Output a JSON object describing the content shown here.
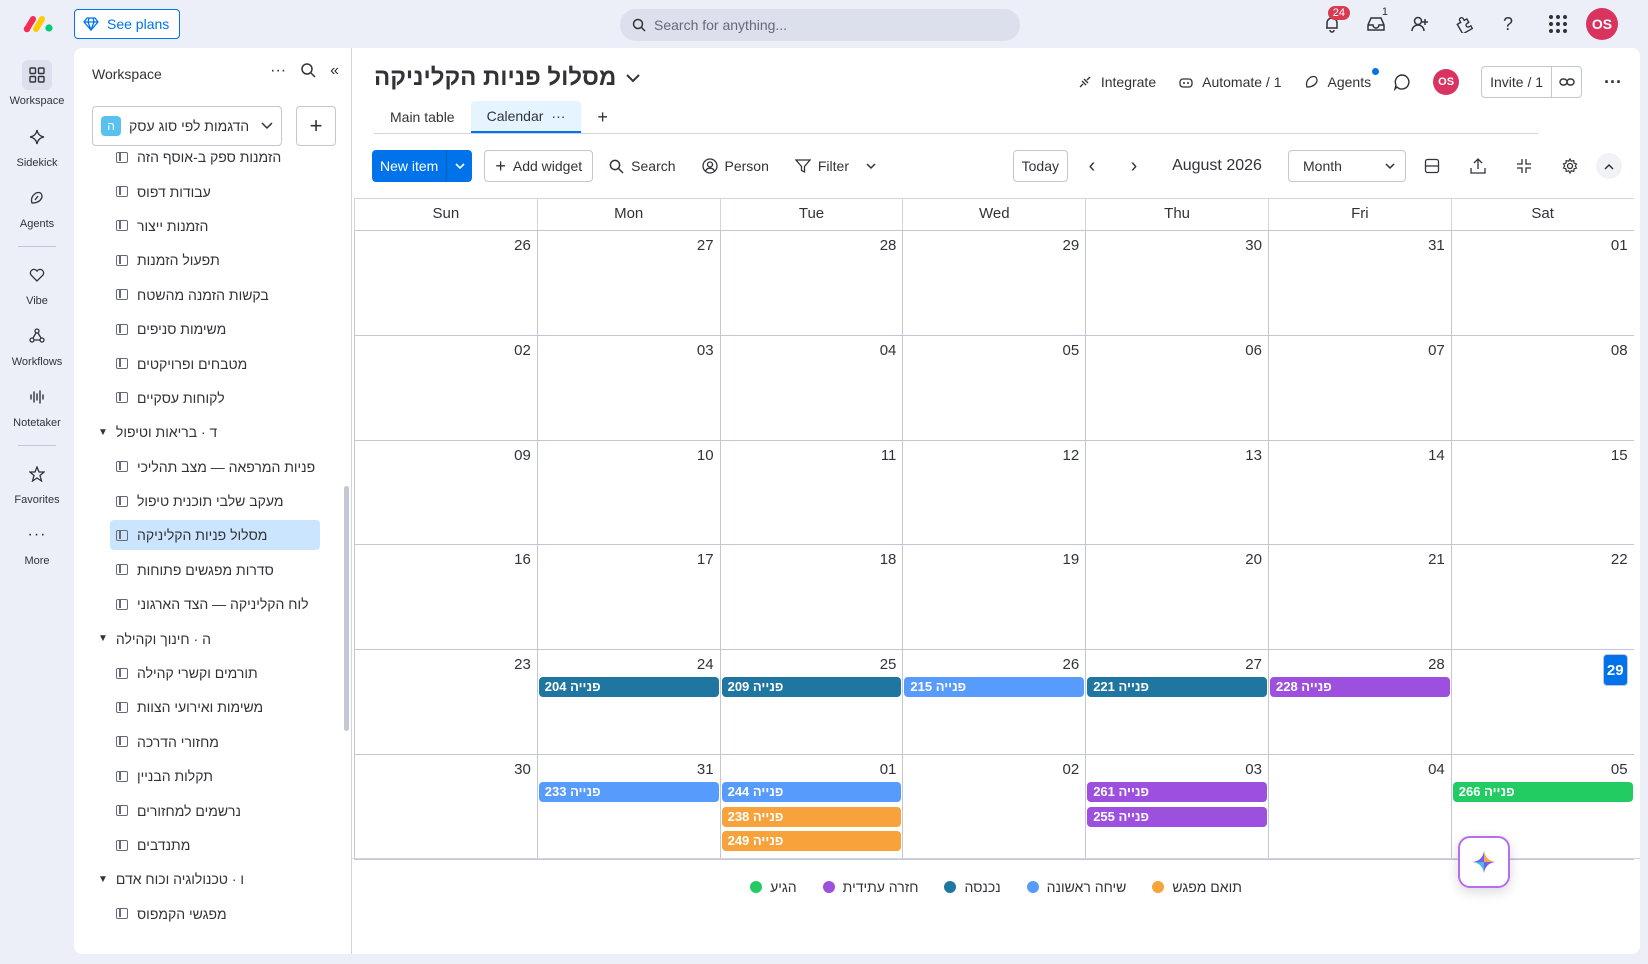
{
  "topbar": {
    "see_plans": "See plans",
    "search_placeholder": "Search for anything...",
    "notifications_count": "24",
    "inbox_count": "1",
    "avatar_initials": "OS"
  },
  "rail": {
    "items": [
      {
        "label": "Workspace",
        "icon": "grid-icon"
      },
      {
        "label": "Sidekick",
        "icon": "sparkle-icon"
      },
      {
        "label": "Agents",
        "icon": "agents-icon"
      },
      {
        "label": "Vibe",
        "icon": "heart-icon"
      },
      {
        "label": "Workflows",
        "icon": "workflows-icon"
      },
      {
        "label": "Notetaker",
        "icon": "waveform-icon"
      },
      {
        "label": "Favorites",
        "icon": "star-icon"
      },
      {
        "label": "More",
        "icon": "more-icon"
      }
    ]
  },
  "sidebar": {
    "title": "Workspace",
    "workspace_badge": "ה",
    "workspace_name": "הדגמות לפי סוג עסק",
    "tree": [
      {
        "type": "board",
        "label": "הזמנות ספק ב-אוסף הזה"
      },
      {
        "type": "board",
        "label": "עבודות דפוס"
      },
      {
        "type": "board",
        "label": "הזמנות ייצור"
      },
      {
        "type": "board",
        "label": "תפעול הזמנות"
      },
      {
        "type": "board",
        "label": "בקשות הזמנה מהשטח"
      },
      {
        "type": "board",
        "label": "משימות סניפים"
      },
      {
        "type": "board",
        "label": "מטבחים ופרויקטים"
      },
      {
        "type": "board",
        "label": "לקוחות עסקיים"
      },
      {
        "type": "folder",
        "label": "ד · בריאות וטיפול"
      },
      {
        "type": "board",
        "label": "פניות המרפאה — מצב תהליכי"
      },
      {
        "type": "board",
        "label": "מעקב שלבי תוכנית טיפול"
      },
      {
        "type": "board",
        "label": "מסלול פניות הקליניקה",
        "selected": true
      },
      {
        "type": "board",
        "label": "סדרות מפגשים פתוחות"
      },
      {
        "type": "board",
        "label": "לוח הקליניקה — הצד הארגוני"
      },
      {
        "type": "folder",
        "label": "ה · חינוך וקהילה"
      },
      {
        "type": "board",
        "label": "תורמים וקשרי קהילה"
      },
      {
        "type": "board",
        "label": "משימות ואירועי הצוות"
      },
      {
        "type": "board",
        "label": "מחזורי הדרכה"
      },
      {
        "type": "board",
        "label": "תקלות הבניין"
      },
      {
        "type": "board",
        "label": "נרשמים למחזורים"
      },
      {
        "type": "board",
        "label": "מתנדבים"
      },
      {
        "type": "folder",
        "label": "ו · טכנולוגיה וכוח אדם"
      },
      {
        "type": "board",
        "label": "מפגשי הקמפוס"
      }
    ]
  },
  "board": {
    "title": "מסלול פניות הקליניקה",
    "integrate": "Integrate",
    "automate": "Automate / 1",
    "agents": "Agents",
    "avatar_initials": "OS",
    "invite": "Invite / 1",
    "tabs": [
      {
        "label": "Main table"
      },
      {
        "label": "Calendar",
        "active": true
      }
    ]
  },
  "toolbar": {
    "new_item": "New item",
    "add_widget": "Add widget",
    "search": "Search",
    "person": "Person",
    "filter": "Filter",
    "today": "Today",
    "month_label": "August 2026",
    "view_select": "Month"
  },
  "calendar": {
    "weekdays": [
      "Sun",
      "Mon",
      "Tue",
      "Wed",
      "Thu",
      "Fri",
      "Sat"
    ],
    "weeks": [
      [
        "26",
        "27",
        "28",
        "29",
        "30",
        "31",
        "01"
      ],
      [
        "02",
        "03",
        "04",
        "05",
        "06",
        "07",
        "08"
      ],
      [
        "09",
        "10",
        "11",
        "12",
        "13",
        "14",
        "15"
      ],
      [
        "16",
        "17",
        "18",
        "19",
        "20",
        "21",
        "22"
      ],
      [
        "23",
        "24",
        "25",
        "26",
        "27",
        "28",
        "29"
      ],
      [
        "30",
        "31",
        "01",
        "02",
        "03",
        "04",
        "05"
      ]
    ],
    "today": {
      "week": 4,
      "day": 6
    },
    "events": [
      {
        "week": 4,
        "day": 1,
        "slot": 0,
        "label": "פנייה 204",
        "color": "#1f76a0"
      },
      {
        "week": 4,
        "day": 2,
        "slot": 0,
        "label": "פנייה 209",
        "color": "#1f76a0"
      },
      {
        "week": 4,
        "day": 3,
        "slot": 0,
        "label": "פנייה 215",
        "color": "#579bfc"
      },
      {
        "week": 4,
        "day": 4,
        "slot": 0,
        "label": "פנייה 221",
        "color": "#1f76a0"
      },
      {
        "week": 4,
        "day": 5,
        "slot": 0,
        "label": "פנייה 228",
        "color": "#9d50dd"
      },
      {
        "week": 5,
        "day": 1,
        "slot": 0,
        "label": "פנייה 233",
        "color": "#579bfc"
      },
      {
        "week": 5,
        "day": 2,
        "slot": 0,
        "label": "פנייה 244",
        "color": "#579bfc"
      },
      {
        "week": 5,
        "day": 2,
        "slot": 1,
        "label": "פנייה 238",
        "color": "#f7a23b"
      },
      {
        "week": 5,
        "day": 2,
        "slot": 2,
        "label": "פנייה 249",
        "color": "#f7a23b"
      },
      {
        "week": 5,
        "day": 4,
        "slot": 0,
        "label": "פנייה 261",
        "color": "#9d50dd"
      },
      {
        "week": 5,
        "day": 4,
        "slot": 1,
        "label": "פנייה 255",
        "color": "#9d50dd"
      },
      {
        "week": 5,
        "day": 6,
        "slot": 0,
        "label": "פנייה 266",
        "color": "#22cc63"
      }
    ]
  },
  "legend": [
    {
      "label": "הגיע",
      "color": "#22cc63"
    },
    {
      "label": "חזרה עתידית",
      "color": "#9d50dd"
    },
    {
      "label": "נכנסה",
      "color": "#1f76a0"
    },
    {
      "label": "שיחה ראשונה",
      "color": "#579bfc"
    },
    {
      "label": "תואם מפגש",
      "color": "#f7a23b"
    }
  ]
}
